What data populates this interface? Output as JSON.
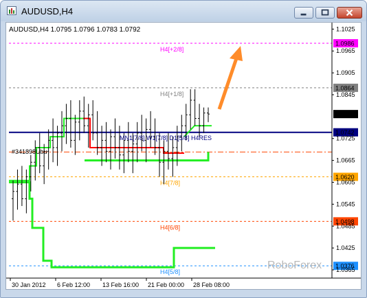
{
  "window": {
    "title": "AUDUSD,H4"
  },
  "chart_header": "AUDUSD,H4  1.0795 1.0796 1.0783 1.0792",
  "watermark": "RoboForex",
  "annotation_left": "#341898Ubu",
  "annotation_center": "MN1[7/8] W1[7/8] D1[5/8] H4RES",
  "colors": {
    "background": "#ffffff",
    "window_frame": "#c9d8ea",
    "candles": "#000000",
    "indicator_green": "#00ff00",
    "indicator_red": "#ff0000",
    "resistance_line": "#000080",
    "arrow": "#ff8c2a",
    "current_price_label": "#000000"
  },
  "chart_data": {
    "type": "candlestick",
    "symbol": "AUDUSD",
    "timeframe": "H4",
    "ohlc_header": {
      "open": 1.0795,
      "high": 1.0796,
      "low": 1.0783,
      "close": 1.0792
    },
    "y_range": [
      1.035,
      1.1035
    ],
    "y_ticks": [
      "1.1025",
      "1.0986",
      "1.0965",
      "1.0905",
      "1.0864",
      "1.0845",
      "1.0792",
      "1.0742",
      "1.0725",
      "1.0665",
      "1.0620",
      "1.0605",
      "1.0545",
      "1.0498",
      "1.0485",
      "1.0425",
      "1.0376",
      "1.0365"
    ],
    "x_ticks": [
      "30 Jan 2012",
      "6 Feb 12:00",
      "13 Feb 16:00",
      "21 Feb 00:00",
      "28 Feb 08:00"
    ],
    "levels": [
      {
        "label": "H4[+2/8]",
        "price": 1.0986,
        "tag": "1.0986",
        "color": "#ff00ff",
        "style": "dashed"
      },
      {
        "label": "H4[+1/8]",
        "price": 1.0864,
        "tag": "1.0864",
        "color": "#808080",
        "style": "dashed"
      },
      {
        "label": "",
        "price": 1.0792,
        "tag": "1.0792",
        "color": "#000000",
        "style": "current"
      },
      {
        "label": "",
        "price": 1.0742,
        "tag": "1.0742",
        "color": "#000080",
        "style": "solid"
      },
      {
        "label": "",
        "price": 1.0688,
        "tag": "",
        "color": "#ff4500",
        "style": "dashdot"
      },
      {
        "label": "H4[7/8]",
        "price": 1.062,
        "tag": "1.0620",
        "color": "#ffa500",
        "style": "dashed"
      },
      {
        "label": "H4[6/8]",
        "price": 1.0498,
        "tag": "1.0498",
        "color": "#ff4500",
        "style": "dashed"
      },
      {
        "label": "H4[5/8]",
        "price": 1.0376,
        "tag": "1.0376",
        "color": "#1e90ff",
        "style": "dashed"
      }
    ],
    "candles": [
      [
        1.056,
        1.061,
        1.05,
        1.058
      ],
      [
        1.058,
        1.064,
        1.053,
        1.06
      ],
      [
        1.06,
        1.065,
        1.054,
        1.056
      ],
      [
        1.056,
        1.064,
        1.052,
        1.062
      ],
      [
        1.062,
        1.068,
        1.058,
        1.066
      ],
      [
        1.066,
        1.072,
        1.061,
        1.07
      ],
      [
        1.07,
        1.074,
        1.063,
        1.065
      ],
      [
        1.065,
        1.071,
        1.06,
        1.069
      ],
      [
        1.069,
        1.075,
        1.064,
        1.072
      ],
      [
        1.072,
        1.078,
        1.066,
        1.07
      ],
      [
        1.07,
        1.076,
        1.065,
        1.074
      ],
      [
        1.074,
        1.08,
        1.069,
        1.076
      ],
      [
        1.076,
        1.082,
        1.071,
        1.078
      ],
      [
        1.078,
        1.083,
        1.07,
        1.072
      ],
      [
        1.072,
        1.079,
        1.068,
        1.077
      ],
      [
        1.077,
        1.083,
        1.072,
        1.08
      ],
      [
        1.08,
        1.084,
        1.074,
        1.076
      ],
      [
        1.076,
        1.082,
        1.07,
        1.079
      ],
      [
        1.079,
        1.083,
        1.072,
        1.074
      ],
      [
        1.074,
        1.08,
        1.068,
        1.07
      ],
      [
        1.07,
        1.076,
        1.065,
        1.072
      ],
      [
        1.072,
        1.077,
        1.066,
        1.069
      ],
      [
        1.069,
        1.075,
        1.064,
        1.073
      ],
      [
        1.073,
        1.078,
        1.067,
        1.07
      ],
      [
        1.07,
        1.076,
        1.064,
        1.068
      ],
      [
        1.068,
        1.074,
        1.063,
        1.072
      ],
      [
        1.072,
        1.077,
        1.066,
        1.069
      ],
      [
        1.069,
        1.074,
        1.063,
        1.071
      ],
      [
        1.071,
        1.077,
        1.066,
        1.074
      ],
      [
        1.074,
        1.079,
        1.069,
        1.072
      ],
      [
        1.072,
        1.078,
        1.066,
        1.075
      ],
      [
        1.075,
        1.08,
        1.07,
        1.073
      ],
      [
        1.073,
        1.078,
        1.068,
        1.07
      ],
      [
        1.07,
        1.074,
        1.062,
        1.066
      ],
      [
        1.066,
        1.072,
        1.06,
        1.069
      ],
      [
        1.069,
        1.074,
        1.064,
        1.067
      ],
      [
        1.067,
        1.073,
        1.062,
        1.07
      ],
      [
        1.07,
        1.076,
        1.065,
        1.073
      ],
      [
        1.073,
        1.079,
        1.069,
        1.076
      ],
      [
        1.076,
        1.082,
        1.072,
        1.079
      ],
      [
        1.079,
        1.086,
        1.075,
        1.083
      ],
      [
        1.083,
        1.086,
        1.076,
        1.078
      ],
      [
        1.078,
        1.082,
        1.073,
        1.076
      ],
      [
        1.076,
        1.081,
        1.074,
        1.0795
      ],
      [
        1.0795,
        1.081,
        1.077,
        1.0792
      ]
    ],
    "indicator_green_steps": [
      {
        "from": 0.0,
        "to": 0.06,
        "price": 1.061
      },
      {
        "from": 0.06,
        "to": 0.1,
        "price": 1.064
      },
      {
        "from": 0.1,
        "to": 0.14,
        "price": 1.068
      },
      {
        "from": 0.14,
        "to": 0.18,
        "price": 1.074
      },
      {
        "from": 0.18,
        "to": 0.26,
        "price": 1.0665
      },
      {
        "from": 0.26,
        "to": 0.72,
        "price": 1.0665
      },
      {
        "from": 0.72,
        "to": 1.0,
        "price": 1.0665
      }
    ],
    "stoploss_green_upper": [
      {
        "from": 0.2,
        "to": 0.55,
        "price": 1.0665
      },
      {
        "from": 0.55,
        "to": 0.95,
        "price": 1.0665
      },
      {
        "from": 0.75,
        "to": 0.95,
        "price": 1.077
      }
    ],
    "red_segment": [
      {
        "from": 0.3,
        "to": 0.42,
        "price": 1.07
      },
      {
        "from": 0.42,
        "to": 0.6,
        "price": 1.07
      },
      {
        "from": 0.6,
        "to": 0.66,
        "price": 1.0685
      }
    ]
  }
}
